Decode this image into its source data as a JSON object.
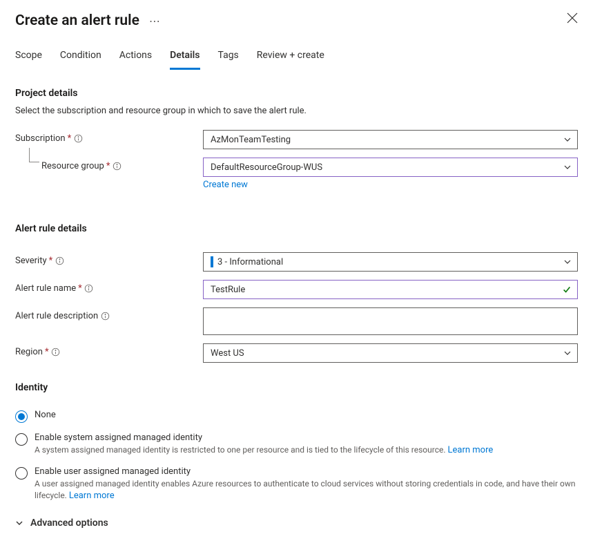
{
  "header": {
    "title": "Create an alert rule"
  },
  "tabs": {
    "items": [
      {
        "label": "Scope",
        "active": false
      },
      {
        "label": "Condition",
        "active": false
      },
      {
        "label": "Actions",
        "active": false
      },
      {
        "label": "Details",
        "active": true
      },
      {
        "label": "Tags",
        "active": false
      },
      {
        "label": "Review + create",
        "active": false
      }
    ]
  },
  "project": {
    "title": "Project details",
    "desc": "Select the subscription and resource group in which to save the alert rule.",
    "subscription_label": "Subscription",
    "subscription_value": "AzMonTeamTesting",
    "rg_label": "Resource group",
    "rg_value": "DefaultResourceGroup-WUS",
    "create_new": "Create new"
  },
  "details": {
    "title": "Alert rule details",
    "severity_label": "Severity",
    "severity_value": "3 - Informational",
    "name_label": "Alert rule name",
    "name_value": "TestRule",
    "desc_label": "Alert rule description",
    "desc_value": "",
    "region_label": "Region",
    "region_value": "West US"
  },
  "identity": {
    "title": "Identity",
    "options": [
      {
        "label": "None",
        "desc": "",
        "selected": true
      },
      {
        "label": "Enable system assigned managed identity",
        "desc": "A system assigned managed identity is restricted to one per resource and is tied to the lifecycle of this resource. ",
        "learn_more": "Learn more",
        "selected": false
      },
      {
        "label": "Enable user assigned managed identity",
        "desc": "A user assigned managed identity enables Azure resources to authenticate to cloud services without storing credentials in code, and have their own lifecycle. ",
        "learn_more": "Learn more",
        "selected": false
      }
    ]
  },
  "advanced": {
    "label": "Advanced options"
  }
}
